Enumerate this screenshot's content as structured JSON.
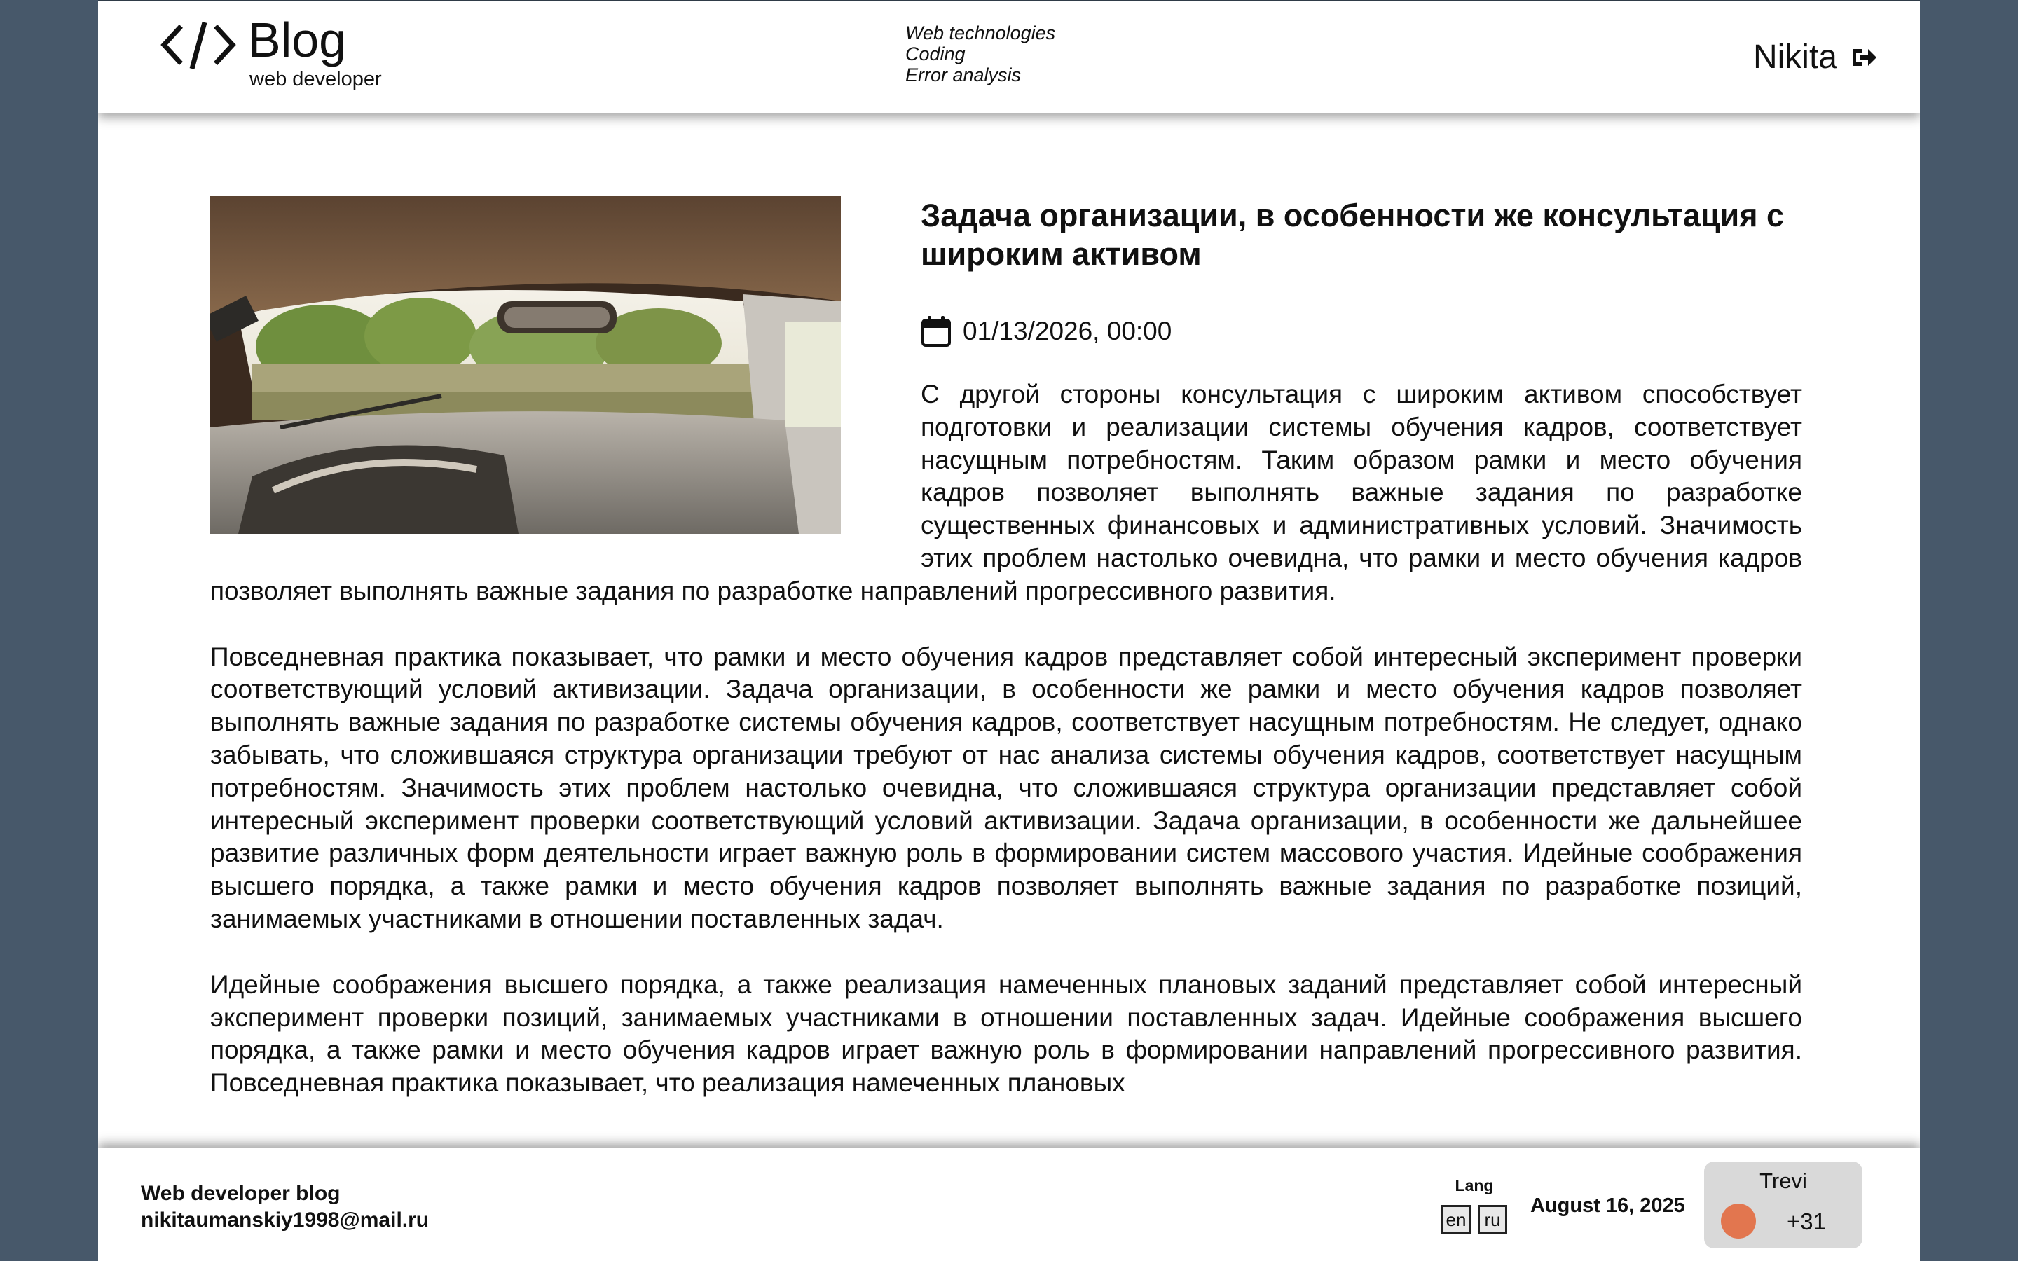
{
  "header": {
    "logo_title": "Blog",
    "logo_subtitle": "web developer",
    "topics": [
      "Web technologies",
      "Coding",
      "Error analysis"
    ],
    "user_name": "Nikita"
  },
  "article": {
    "title": "Задача организации, в особенности же консультация с широким активом",
    "date": "01/13/2026, 00:00",
    "paragraphs": [
      "С другой стороны консультация с широким активом способствует подготовки и реализации системы обучения кадров, соответствует насущным потребностям. Таким образом рамки и место обучения кадров позволяет выполнять важные задания по разработке существенных финансовых и административных условий. Значимость этих проблем настолько очевидна, что рамки и место обучения кадров позволяет выполнять важные задания по разработке направлений прогрессивного развития.",
      "Повседневная практика показывает, что рамки и место обучения кадров представляет собой интересный эксперимент проверки соответствующий условий активизации. Задача организации, в особенности же рамки и место обучения кадров позволяет выполнять важные задания по разработке системы обучения кадров, соответствует насущным потребностям. Не следует, однако забывать, что сложившаяся структура организации требуют от нас анализа системы обучения кадров, соответствует насущным потребностям. Значимость этих проблем настолько очевидна, что сложившаяся структура организации представляет собой интересный эксперимент проверки соответствующий условий активизации. Задача организации, в особенности же дальнейшее развитие различных форм деятельности играет важную роль в формировании систем массового участия. Идейные соображения высшего порядка, а также рамки и место обучения кадров позволяет выполнять важные задания по разработке позиций, занимаемых участниками в отношении поставленных задач.",
      "Идейные соображения высшего порядка, а также реализация намеченных плановых заданий представляет собой интересный эксперимент проверки позиций, занимаемых участниками в отношении поставленных задач. Идейные соображения высшего порядка, а также рамки и место обучения кадров играет важную роль в формировании направлений прогрессивного развития. Повседневная практика показывает, что реализация намеченных плановых"
    ]
  },
  "footer": {
    "title": "Web developer blog",
    "email": "nikitaumanskiy1998@mail.ru",
    "lang_label": "Lang",
    "lang_options": [
      "en",
      "ru"
    ],
    "date": "August 16, 2025",
    "weather": {
      "city": "Trevi",
      "temperature": "+31",
      "icon": "sun-icon",
      "icon_color": "#e2764f"
    }
  },
  "colors": {
    "background": "#47586a",
    "page": "#ffffff",
    "weather_card": "#d9d9d9"
  }
}
